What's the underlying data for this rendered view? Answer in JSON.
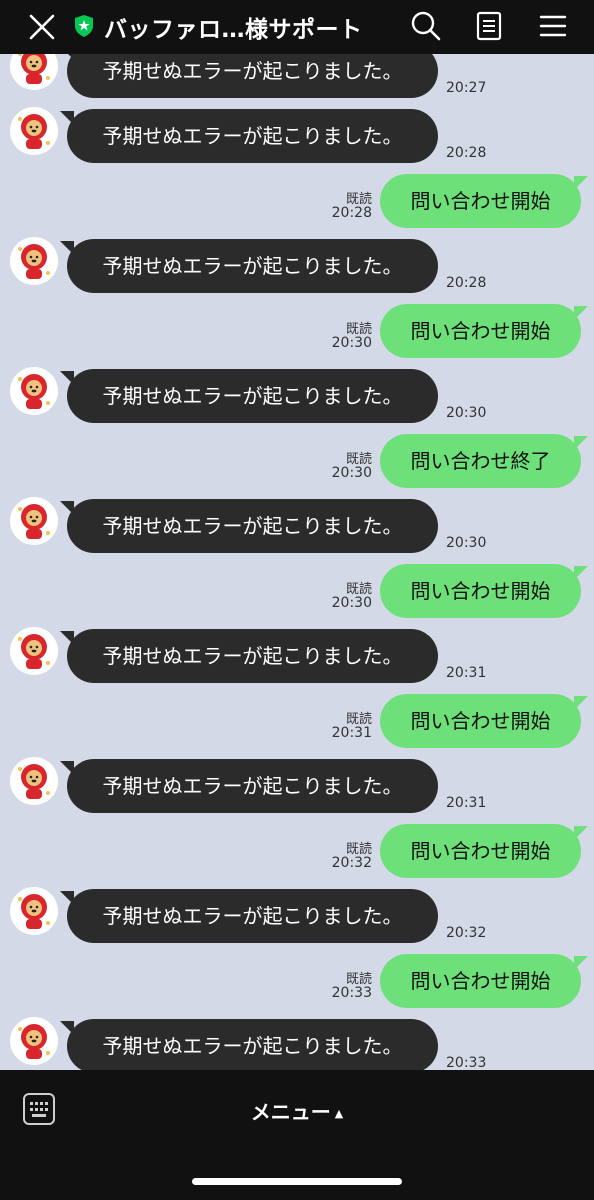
{
  "header": {
    "title": "バッファロ…様サポート"
  },
  "bot": {
    "message_text": "予期せぬエラーが起こりました。"
  },
  "messages": [
    {
      "type": "bot",
      "text": "予期せぬエラーが起こりました。",
      "time": "20:27"
    },
    {
      "type": "bot",
      "text": "予期せぬエラーが起こりました。",
      "time": "20:28"
    },
    {
      "type": "user",
      "text": "問い合わせ開始",
      "read": "既読",
      "time": "20:28"
    },
    {
      "type": "bot",
      "text": "予期せぬエラーが起こりました。",
      "time": "20:28"
    },
    {
      "type": "user",
      "text": "問い合わせ開始",
      "read": "既読",
      "time": "20:30"
    },
    {
      "type": "bot",
      "text": "予期せぬエラーが起こりました。",
      "time": "20:30"
    },
    {
      "type": "user",
      "text": "問い合わせ終了",
      "read": "既読",
      "time": "20:30"
    },
    {
      "type": "bot",
      "text": "予期せぬエラーが起こりました。",
      "time": "20:30"
    },
    {
      "type": "user",
      "text": "問い合わせ開始",
      "read": "既読",
      "time": "20:30"
    },
    {
      "type": "bot",
      "text": "予期せぬエラーが起こりました。",
      "time": "20:31"
    },
    {
      "type": "user",
      "text": "問い合わせ開始",
      "read": "既読",
      "time": "20:31"
    },
    {
      "type": "bot",
      "text": "予期せぬエラーが起こりました。",
      "time": "20:31"
    },
    {
      "type": "user",
      "text": "問い合わせ開始",
      "read": "既読",
      "time": "20:32"
    },
    {
      "type": "bot",
      "text": "予期せぬエラーが起こりました。",
      "time": "20:32"
    },
    {
      "type": "user",
      "text": "問い合わせ開始",
      "read": "既読",
      "time": "20:33"
    },
    {
      "type": "bot",
      "text": "予期せぬエラーが起こりました。",
      "time": "20:33"
    }
  ],
  "footer": {
    "menu_label": "メニュー",
    "caret": "▲"
  },
  "colors": {
    "background": "#d3d9e6",
    "bot_bubble": "#2b2b2b",
    "user_bubble": "#6ee07a",
    "header": "#111111",
    "badge_green": "#06c755"
  },
  "icons": [
    "close-icon",
    "verified-badge-icon",
    "search-icon",
    "notes-icon",
    "menu-icon",
    "keyboard-icon",
    "avatar-icon"
  ]
}
